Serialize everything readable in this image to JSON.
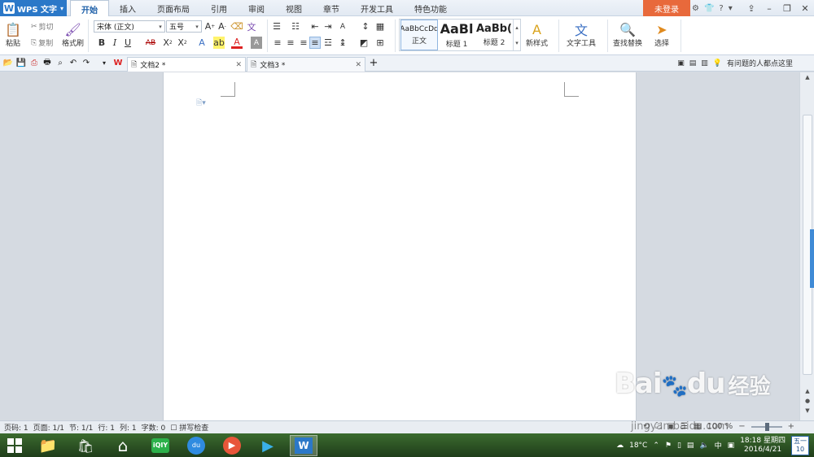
{
  "app": {
    "name": "WPS 文字"
  },
  "menu": {
    "tabs": [
      "开始",
      "插入",
      "页面布局",
      "引用",
      "审阅",
      "视图",
      "章节",
      "开发工具",
      "特色功能"
    ],
    "active": "开始",
    "login_label": "未登录",
    "help_label": "?"
  },
  "ribbon": {
    "clipboard": {
      "paste": "粘贴",
      "cut": "剪切",
      "copy": "复制",
      "format_painter": "格式刷"
    },
    "font": {
      "family": "宋体 (正文)",
      "size": "五号"
    },
    "styles": [
      {
        "sample": "AaBbCcDd",
        "name": "正文"
      },
      {
        "sample": "AaBl",
        "name": "标题 1"
      },
      {
        "sample": "AaBb(",
        "name": "标题 2"
      }
    ],
    "new_style": "新样式",
    "text_tools": "文字工具",
    "find_replace": "查找替换",
    "select": "选择"
  },
  "docbar": {
    "tabs": [
      {
        "label": "文档2 *",
        "active": true
      },
      {
        "label": "文档3 *",
        "active": false
      }
    ],
    "feedback": "有问题的人都点这里"
  },
  "statusbar": {
    "page_num": "页码: 1",
    "pages": "页面: 1/1",
    "section": "节: 1/1",
    "row": "行: 1",
    "col": "列: 1",
    "words": "字数: 0",
    "spell": "拼写检查",
    "zoom": "100 %"
  },
  "taskbar": {
    "weather": "18°C",
    "ime": "中",
    "time": "18:18 星期四",
    "date": "2016/4/21",
    "cal_day": "五一",
    "cal_num": "10"
  },
  "watermark": {
    "brand": "Bai",
    "brand2": "du",
    "cn": "经验",
    "url": "jingyan.baidu.com"
  }
}
